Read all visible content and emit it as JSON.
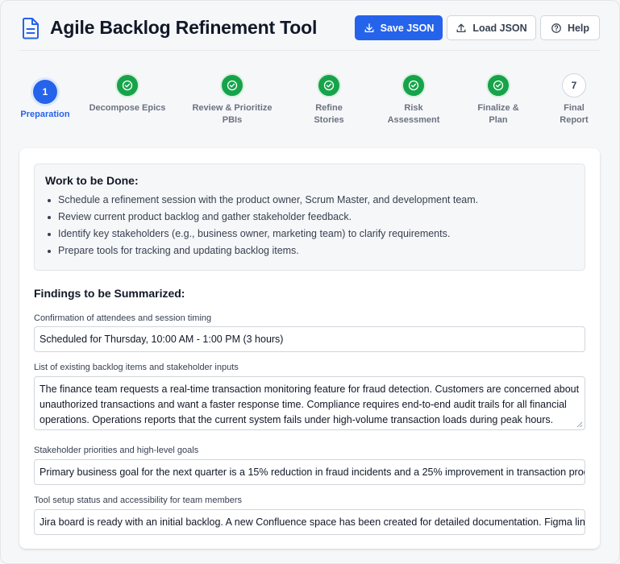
{
  "header": {
    "title": "Agile Backlog Refinement Tool",
    "buttons": {
      "save": "Save JSON",
      "load": "Load JSON",
      "help": "Help"
    }
  },
  "stepper": {
    "steps": [
      {
        "marker": "1",
        "label": "Preparation",
        "state": "active"
      },
      {
        "marker": "",
        "label": "Decompose Epics",
        "state": "done"
      },
      {
        "marker": "",
        "label": "Review & Prioritize PBIs",
        "state": "done"
      },
      {
        "marker": "",
        "label": "Refine Stories",
        "state": "done"
      },
      {
        "marker": "",
        "label": "Risk Assessment",
        "state": "done"
      },
      {
        "marker": "",
        "label": "Finalize & Plan",
        "state": "done"
      },
      {
        "marker": "7",
        "label": "Final Report",
        "state": "todo"
      }
    ]
  },
  "work": {
    "title": "Work to be Done:",
    "items": [
      "Schedule a refinement session with the product owner, Scrum Master, and development team.",
      "Review current product backlog and gather stakeholder feedback.",
      "Identify key stakeholders (e.g., business owner, marketing team) to clarify requirements.",
      "Prepare tools for tracking and updating backlog items."
    ]
  },
  "findings": {
    "title": "Findings to be Summarized:",
    "fields": [
      {
        "label": "Confirmation of attendees and session timing",
        "value": "Scheduled for Thursday, 10:00 AM - 1:00 PM (3 hours)"
      },
      {
        "label": "List of existing backlog items and stakeholder inputs",
        "value": "The finance team requests a real-time transaction monitoring feature for fraud detection. Customers are concerned about unauthorized transactions and want a faster response time. Compliance requires end-to-end audit trails for all financial operations. Operations reports that the current system fails under high-volume transaction loads during peak hours."
      },
      {
        "label": "Stakeholder priorities and high-level goals",
        "value": "Primary business goal for the next quarter is a 15% reduction in fraud incidents and a 25% improvement in transaction proce"
      },
      {
        "label": "Tool setup status and accessibility for team members",
        "value": "Jira board is ready with an initial backlog. A new Confluence space has been created for detailed documentation. Figma links"
      }
    ]
  },
  "colors": {
    "accent": "#2563eb",
    "done": "#16a34a",
    "background": "#f6f7f9"
  }
}
